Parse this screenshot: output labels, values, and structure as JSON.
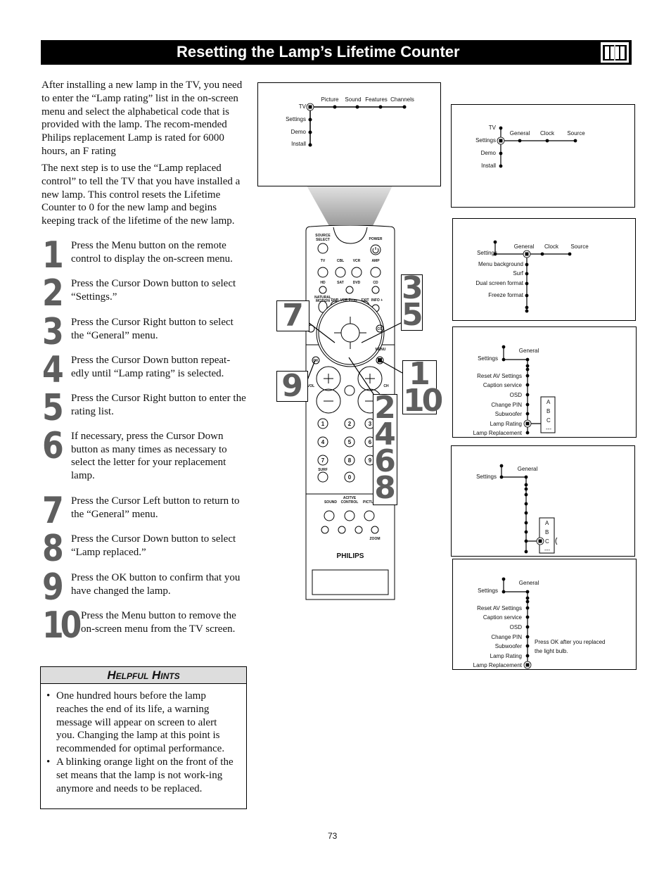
{
  "header": {
    "title": "Resetting the Lamp’s Lifetime Counter",
    "icon": "book-icon"
  },
  "intro": [
    "After installing a new lamp in the TV, you need to enter the “Lamp rating” list in the on-screen menu and select the alphabetical code that is provided with the lamp. The recom-mended Philips replacement Lamp is rated for 6000 hours, an F rating",
    "The next step is to use the “Lamp replaced control” to tell the TV that you have installed a new lamp. This control resets the Lifetime Counter to 0 for the new lamp and begins keeping track of the lifetime of the new lamp."
  ],
  "steps": [
    {
      "n": "1",
      "text": "Press the Menu button on the remote control to display the on-screen menu."
    },
    {
      "n": "2",
      "text": "Press the Cursor Down button to select “Settings.”"
    },
    {
      "n": "3",
      "text": "Press the Cursor Right button to select the “General” menu."
    },
    {
      "n": "4",
      "text": "Press the Cursor Down button repeat-edly until “Lamp rating” is selected."
    },
    {
      "n": "5",
      "text": "Press the Cursor Right button to enter the rating list."
    },
    {
      "n": "6",
      "text": "If necessary, press the Cursor Down button as many times as necessary to select the letter for your replacement lamp."
    },
    {
      "n": "7",
      "text": "Press the Cursor Left button to return to the “General” menu."
    },
    {
      "n": "8",
      "text": "Press the Cursor Down button to select “Lamp replaced.”"
    },
    {
      "n": "9",
      "text": "Press the OK button to confirm that you have changed the lamp."
    },
    {
      "n": "10",
      "text": "Press the Menu button to remove the on-screen menu from the TV screen."
    }
  ],
  "hints": {
    "title": "Helpful Hints",
    "items": [
      "One hundred hours before the lamp reaches the end of its life, a warning message will appear on screen to alert you. Changing the lamp at this point is recommended for optimal performance.",
      "A blinking orange light on the front of the set means that the lamp is not work-ing anymore and needs to be replaced."
    ]
  },
  "screens": {
    "s1": {
      "left": [
        "TV",
        "Settings",
        "Demo",
        "Install"
      ],
      "top": [
        "Picture",
        "Sound",
        "Features",
        "Channels"
      ]
    },
    "s2": {
      "left": [
        "TV",
        "Settings",
        "Demo",
        "Install"
      ],
      "top": [
        "General",
        "Clock",
        "Source"
      ]
    },
    "s3": {
      "parent": "Settings",
      "top": [
        "General",
        "Clock",
        "Source"
      ],
      "items": [
        "Menu background",
        "Surf",
        "Dual screen format",
        "Freeze format"
      ]
    },
    "s4": {
      "parent": "Settings",
      "top": "General",
      "items": [
        "Reset AV Settings",
        "Caption service",
        "OSD",
        "Change PIN",
        "Subwoofer",
        "Lamp Rating",
        "Lamp Replacement"
      ],
      "letters": [
        "A",
        "B",
        "C",
        "---"
      ]
    },
    "s5": {
      "parent": "Settings",
      "top": "General",
      "letters": [
        "A",
        "B",
        "C",
        "---"
      ]
    },
    "s6": {
      "parent": "Settings",
      "top": "General",
      "items": [
        "Reset AV Settings",
        "Caption service",
        "OSD",
        "Change PIN",
        "Subwoofer",
        "Lamp Rating",
        "Lamp Replacement"
      ],
      "message": [
        "Press OK after you replaced",
        "the light bulb."
      ]
    }
  },
  "remote": {
    "labels": {
      "source": "SOURCE",
      "select": "SELECT",
      "power": "POWER",
      "tv": "TV",
      "cbl": "CBL",
      "vcr": "VCR",
      "amp": "AMP",
      "hd": "HD",
      "sat": "SAT",
      "dvd": "DVD",
      "cd": "CD",
      "natural": "NATURAL",
      "motion": "MOTION",
      "dnr": "DNR",
      "vcrprog": "VCR Prog.",
      "exit": "EXIT",
      "info": "INFO +",
      "cc": "CC",
      "menu": "MENU",
      "ok": "OK",
      "vol": "VOL",
      "ch": "CH",
      "surf": "SURF",
      "active": "ACITVE",
      "sound": "SOUND",
      "control": "CONTROL",
      "picture": "PICTURE",
      "zoom": "ZOOM",
      "brand": "PHILIPS"
    },
    "digits": [
      "1",
      "2",
      "3",
      "4",
      "5",
      "6",
      "7",
      "8",
      "9",
      "0"
    ]
  },
  "callouts": {
    "c35": [
      "3",
      "5"
    ],
    "c7": [
      "7"
    ],
    "c110": [
      "1",
      "10"
    ],
    "c9": [
      "9"
    ],
    "c2468": [
      "2",
      "4",
      "6",
      "8"
    ]
  },
  "page_number": "73"
}
